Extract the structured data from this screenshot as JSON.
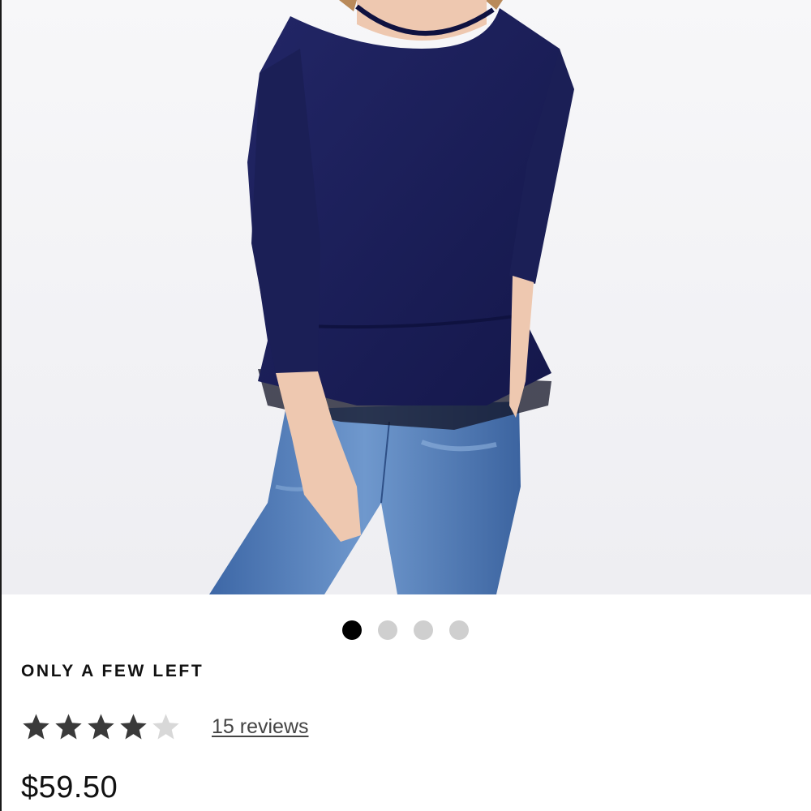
{
  "product": {
    "image_description_icon": "product-photo",
    "carousel": {
      "total": 4,
      "active_index": 0
    },
    "stock_note": "ONLY A FEW LEFT",
    "rating": {
      "value": 4,
      "max": 5
    },
    "reviews_link": "15 reviews",
    "price": "$59.50"
  },
  "colors": {
    "sweater": "#1c1f5e",
    "jeans": "#5b86bf",
    "star_filled": "#3a3a3a",
    "star_empty": "#d8d8d8",
    "dot_active": "#000000",
    "dot_inactive": "#cfcfcf"
  }
}
